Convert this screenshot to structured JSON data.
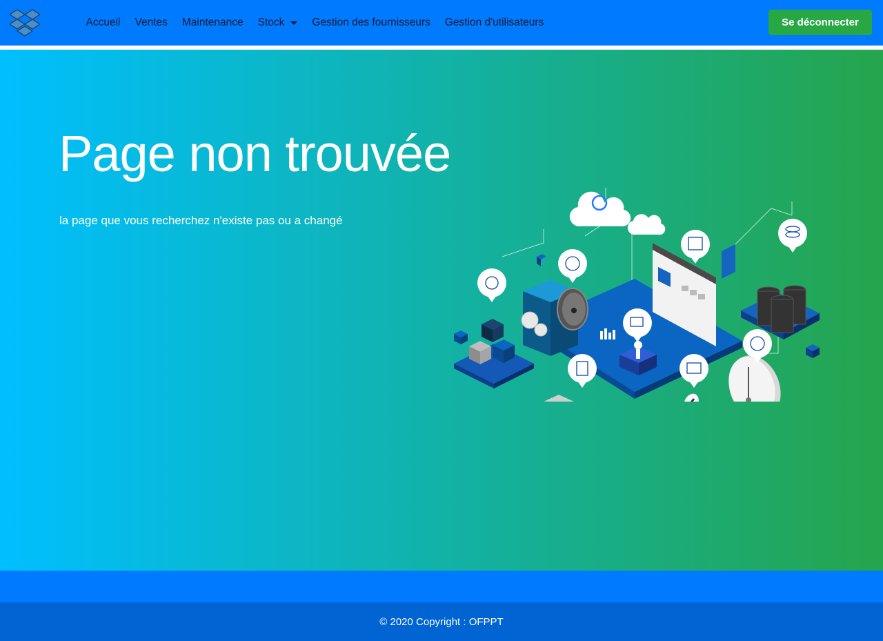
{
  "navbar": {
    "logo_icon": "dropbox-box-icon",
    "links": [
      {
        "label": "Accueil"
      },
      {
        "label": "Ventes"
      },
      {
        "label": "Maintenance"
      },
      {
        "label": "Stock"
      },
      {
        "label": "Gestion des fournisseurs"
      },
      {
        "label": "Gestion d'utilisateurs"
      }
    ],
    "logout_label": "Se déconnecter"
  },
  "hero": {
    "title": "Page non trouvée",
    "subtitle": "la page que vous recherchez n'existe pas ou a changé",
    "illustration_icon": "isometric-datacenter-illustration"
  },
  "footer": {
    "copyright": "© 2020 Copyright : OFPPT"
  },
  "colors": {
    "navbar": "#007bff",
    "logout_button": "#28a745",
    "hero_gradient_start": "#00bfff",
    "hero_gradient_end": "#25a54c",
    "footer_bottom": "#0064d2"
  }
}
